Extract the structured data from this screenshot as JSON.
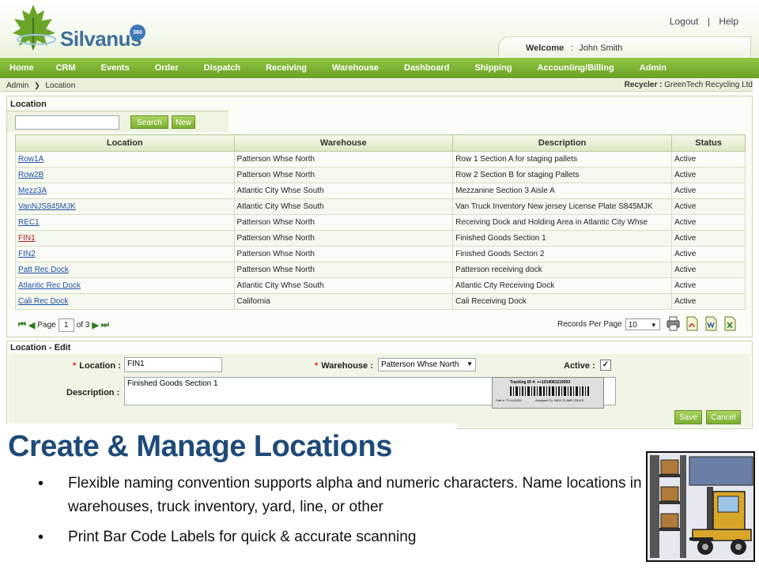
{
  "header": {
    "logo_text": "Silvanus",
    "logo_badge": "360",
    "logout": "Logout",
    "separator": "|",
    "help": "Help",
    "welcome_label": "Welcome",
    "welcome_sep": ":",
    "user_name": "John Smith"
  },
  "nav": [
    "Home",
    "CRM",
    "Events",
    "Order",
    "Dispatch",
    "Receiving",
    "Warehouse",
    "Dashboard",
    "Shipping",
    "Accounting/Billing",
    "Admin"
  ],
  "breadcrumb": {
    "root": "Admin",
    "arrow": "❯",
    "current": "Location",
    "recycler_label": "Recycler :",
    "recycler_value": "GreenTech Recycling Ltd"
  },
  "location_panel": {
    "title": "Location",
    "search_placeholder": "",
    "search_button": "Search",
    "new_button": "New",
    "columns": [
      "Location",
      "Warehouse",
      "Description",
      "Status"
    ],
    "rows": [
      {
        "location": "Row1A",
        "warehouse": "Patterson Whse North",
        "description": "Row 1 Section A for staging pallets",
        "status": "Active"
      },
      {
        "location": "Row2B",
        "warehouse": "Patterson Whse North",
        "description": "Row 2 Section B for staging Pallets",
        "status": "Active"
      },
      {
        "location": "Mezz3A",
        "warehouse": "Atlantic City Whse South",
        "description": "Mezzanine Section 3 Aisle A",
        "status": "Active"
      },
      {
        "location": "VanNJS845MJK",
        "warehouse": "Atlantic City Whse South",
        "description": "Van Truck Inventory New jersey License Plate S845MJK",
        "status": "Active"
      },
      {
        "location": "REC1",
        "warehouse": "Patterson Whse North",
        "description": "Receiving Dock and Holding Area in Atlantic City Whse",
        "status": "Active"
      },
      {
        "location": "FIN1",
        "warehouse": "Patterson Whse North",
        "description": "Finished Goods Section 1",
        "status": "Active"
      },
      {
        "location": "FIN2",
        "warehouse": "Patterson Whse North",
        "description": "Finished Goods Secton 2",
        "status": "Active"
      },
      {
        "location": "Patt Rec Dock",
        "warehouse": "Patterson Whse North",
        "description": "Patterson receiving dock",
        "status": "Active"
      },
      {
        "location": "Atlantic Rec Dock",
        "warehouse": "Atlantic City Whse South",
        "description": "Atlantic City Receiving Dock",
        "status": "Active"
      },
      {
        "location": "Cali Rec Dock",
        "warehouse": "California",
        "description": "Cali Receiving Dock",
        "status": "Active"
      }
    ],
    "pager": {
      "first": "⏮",
      "prev": "◀",
      "page_label": "Page",
      "page_value": "1",
      "of_label": "of 3",
      "next": "▶",
      "last": "⏭",
      "records_label": "Records Per Page",
      "records_value": "10"
    }
  },
  "edit_panel": {
    "title": "Location - Edit",
    "required_mark": "*",
    "location_label": "Location :",
    "location_value": "FIN1",
    "warehouse_label": "Warehouse :",
    "warehouse_value": "Patterson Whse North",
    "active_label": "Active :",
    "active_checked": "✓",
    "description_label": "Description :",
    "description_value": "Finished Goods Section 1",
    "barcode_label": {
      "tracking": "Tracking ID #: ++1014081219503",
      "part": "Part #: TY-LA1000",
      "assigned": "Assigned To: INDY CLIMB TRUCK"
    },
    "save_button": "Save",
    "cancel_button": "Cancel"
  },
  "slide": {
    "title": "Create & Manage Locations",
    "bullets": [
      "Flexible naming convention supports alpha and numeric characters. Name locations in warehouses, truck inventory, yard, line, or other",
      "Print Bar Code Labels for quick & accurate scanning"
    ]
  },
  "colors": {
    "nav_green": "#7cb332",
    "title_blue": "#1f4a78",
    "link_blue": "#1f4fa8"
  }
}
